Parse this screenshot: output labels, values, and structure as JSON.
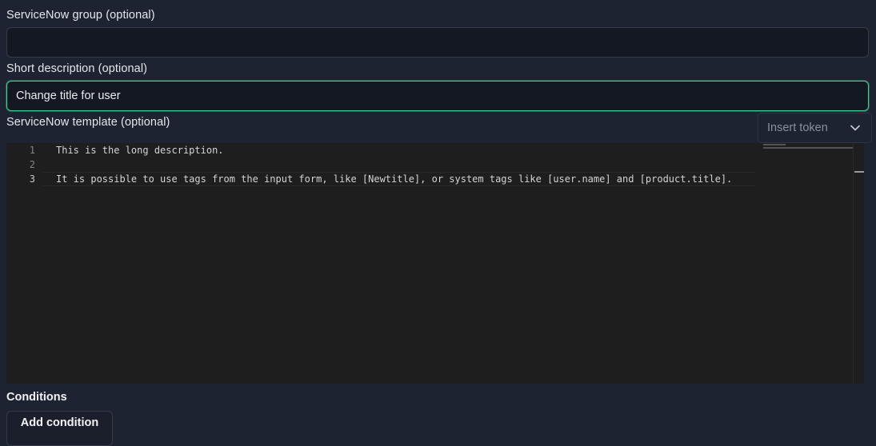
{
  "form": {
    "group_label": "ServiceNow group (optional)",
    "group_value": "",
    "short_description_label": "Short description (optional)",
    "short_description_value": "Change title for user",
    "template_label": "ServiceNow template (optional)",
    "insert_token_placeholder": "Insert token"
  },
  "editor": {
    "lines": [
      {
        "number": "1",
        "text": "This is the long description."
      },
      {
        "number": "2",
        "text": ""
      },
      {
        "number": "3",
        "text": "It is possible to use tags from the input form, like [Newtitle], or system tags like [user.name] and [product.title]."
      }
    ],
    "active_line": 3
  },
  "conditions": {
    "heading": "Conditions",
    "add_button_label": "Add condition"
  },
  "colors": {
    "background": "#1d2331",
    "input_background": "#141823",
    "focus_accent": "#3ccf8e",
    "editor_background": "#1e1e1e"
  },
  "icons": {
    "dropdown": "chevron-down-icon"
  }
}
